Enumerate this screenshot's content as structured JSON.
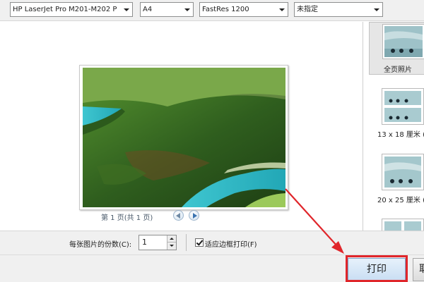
{
  "toolbar": {
    "printer": "HP LaserJet Pro M201-M202 P",
    "paper_size": "A4",
    "quality": "FastRes 1200",
    "paper_type": "未指定"
  },
  "preview": {
    "page_text": "第 1 页(共 1 页)"
  },
  "layouts": [
    {
      "label": "全页照片",
      "selected": true
    },
    {
      "label": "13 x 18 厘米 (",
      "selected": false
    },
    {
      "label": "20 x 25 厘米 (",
      "selected": false
    }
  ],
  "options": {
    "copies_label": "每张图片的份数(C):",
    "copies_value": "1",
    "fit_label": "适应边框打印(F)",
    "fit_checked": true
  },
  "buttons": {
    "print": "打印",
    "cancel_partial": "取"
  },
  "annotation": {
    "color": "#e0262b"
  }
}
